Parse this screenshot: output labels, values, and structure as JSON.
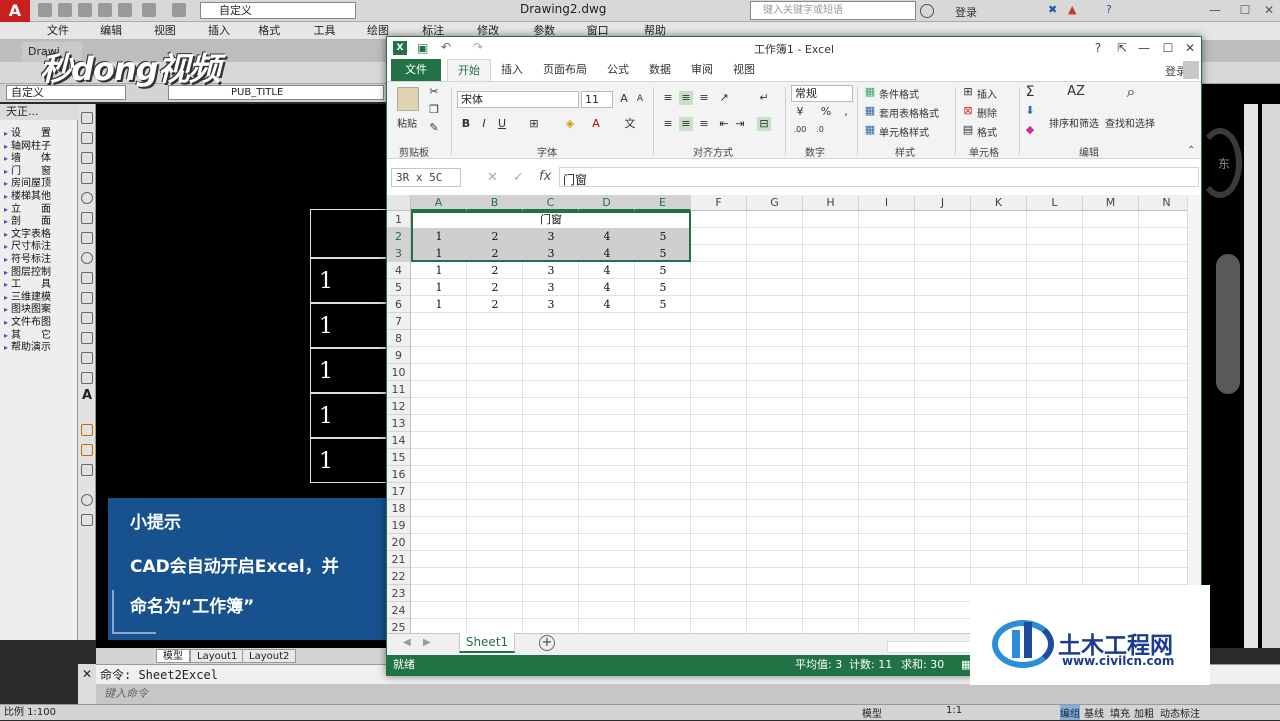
{
  "cad": {
    "menu": [
      "文件(F)",
      "编辑(E)",
      "视图(V)",
      "插入(I)",
      "格式(O)",
      "工具(T)",
      "绘图(D)",
      "标注(N)",
      "修改(M)",
      "参数(P)",
      "窗口(W)",
      "帮助(H)"
    ],
    "workspace": "自定义",
    "doc_title": "Drawing2.dwg",
    "search_placeholder": "键入关键字或短语",
    "login": "登录",
    "tab": "Drawi",
    "style_combo": "自定义",
    "layer_combo": "PUB_TITLE",
    "panel_title": "天正...",
    "panel_items": [
      "设　　置",
      "轴网柱子",
      "墙　　体",
      "门　　窗",
      "房间屋顶",
      "楼梯其他",
      "立　　面",
      "剖　　面",
      "文字表格",
      "尺寸标注",
      "符号标注",
      "图层控制",
      "工　　具",
      "三维建模",
      "图块图案",
      "文件布图",
      "其　　它",
      "帮助演示"
    ],
    "drawing_cells": [
      "1",
      "1",
      "1",
      "1",
      "1"
    ],
    "east": "东",
    "layout_tabs": [
      "模型",
      "Layout1",
      "Layout2"
    ],
    "command": "命令: Sheet2Excel",
    "command_prompt": "键入命令",
    "status_left": "比例 1:100",
    "status_right": [
      "模型",
      "1:1",
      "编组",
      "基线",
      "填充",
      "加粗",
      "动态标注"
    ]
  },
  "watermark": "秒dong视频",
  "tip": {
    "title": "小提示",
    "line1": "CAD会自动开启Excel，并",
    "line2": "命名为“工作簿”"
  },
  "excel": {
    "title": "工作簿1 - Excel",
    "tabs": [
      "文件",
      "开始",
      "插入",
      "页面布局",
      "公式",
      "数据",
      "审阅",
      "视图"
    ],
    "login": "登录",
    "font_name": "宋体",
    "font_size": "11",
    "number_format": "常规",
    "ribbon": {
      "paste": "粘贴",
      "cond_format": "条件格式",
      "table_format": "套用表格格式",
      "cell_style": "单元格样式",
      "insert": "插入",
      "delete": "删除",
      "format": "格式",
      "sort_filter": "排序和筛选",
      "find_select": "查找和选择",
      "groups": [
        "剪贴板",
        "字体",
        "对齐方式",
        "数字",
        "样式",
        "单元格",
        "编辑"
      ]
    },
    "name_box": "3R x 5C",
    "formula": "门窗",
    "columns": [
      "A",
      "B",
      "C",
      "D",
      "E",
      "F",
      "G",
      "H",
      "I",
      "J",
      "K",
      "L",
      "M",
      "N"
    ],
    "rows": [
      "1",
      "2",
      "3",
      "4",
      "5",
      "6",
      "7",
      "8",
      "9",
      "10",
      "11",
      "12",
      "13",
      "14",
      "15",
      "16",
      "17",
      "18",
      "19",
      "20",
      "21",
      "22",
      "23",
      "24",
      "25"
    ],
    "merged_header": "门窗",
    "data_rows": [
      [
        "1",
        "2",
        "3",
        "4",
        "5"
      ],
      [
        "1",
        "2",
        "3",
        "4",
        "5"
      ],
      [
        "1",
        "2",
        "3",
        "4",
        "5"
      ],
      [
        "1",
        "2",
        "3",
        "4",
        "5"
      ],
      [
        "1",
        "2",
        "3",
        "4",
        "5"
      ]
    ],
    "sheet": "Sheet1",
    "status_ready": "就绪",
    "status_avg": "平均值: 3",
    "status_count": "计数: 11",
    "status_sum": "求和: 30"
  },
  "brand": {
    "name": "土木工程网",
    "url": "www.civilcn.com"
  }
}
